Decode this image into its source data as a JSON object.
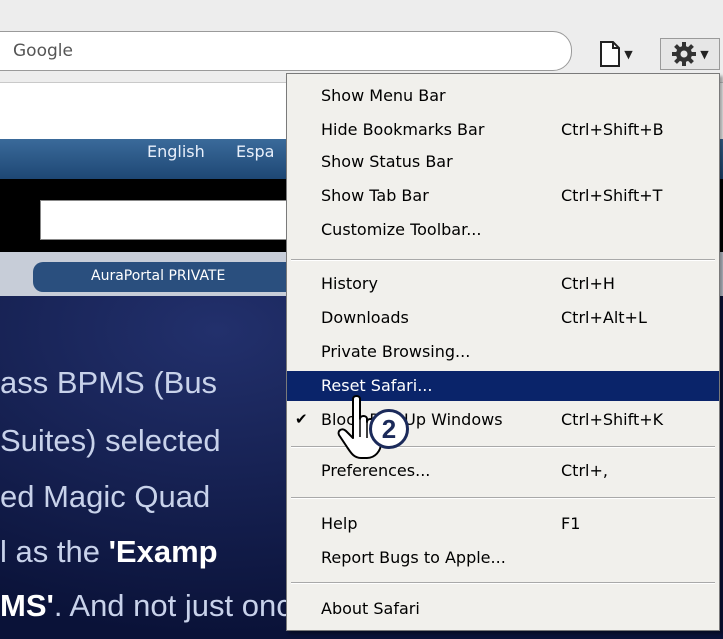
{
  "toolbar": {
    "search_placeholder": "Google",
    "page_icon": "page-icon",
    "gear_icon": "gear-icon"
  },
  "website": {
    "lang_english": "English",
    "lang_espanol": "Espa",
    "nav_text": "AuraPortal  PRIVATE",
    "body_lines": [
      {
        "pre": "ass BPMS (Bus",
        "bold": "",
        "post": ""
      },
      {
        "pre": "Suites) selected",
        "bold": "",
        "post": ""
      },
      {
        "pre": "ed Magic Quad",
        "bold": "",
        "post": ""
      },
      {
        "pre": "l as the ",
        "bold": "'Examp",
        "post": ""
      },
      {
        "pre": "",
        "bold": "MS'",
        "post": ". And not just once"
      }
    ]
  },
  "menu": {
    "items": [
      {
        "label": "Show Menu Bar",
        "shortcut": ""
      },
      {
        "label": "Hide Bookmarks Bar",
        "shortcut": "Ctrl+Shift+B"
      },
      {
        "label": "Show Status Bar",
        "shortcut": ""
      },
      {
        "label": "Show Tab Bar",
        "shortcut": "Ctrl+Shift+T"
      },
      {
        "label": "Customize Toolbar...",
        "shortcut": ""
      },
      {
        "label": "History",
        "shortcut": "Ctrl+H"
      },
      {
        "label": "Downloads",
        "shortcut": "Ctrl+Alt+L"
      },
      {
        "label": "Private Browsing...",
        "shortcut": ""
      },
      {
        "label": "Reset Safari...",
        "shortcut": ""
      },
      {
        "label": "Block Pop-Up Windows",
        "shortcut": "Ctrl+Shift+K",
        "checked": true
      },
      {
        "label": "Preferences...",
        "shortcut": "Ctrl+,"
      },
      {
        "label": "Help",
        "shortcut": "F1"
      },
      {
        "label": "Report Bugs to Apple...",
        "shortcut": ""
      },
      {
        "label": "About Safari",
        "shortcut": ""
      }
    ],
    "selected_index": 8
  },
  "annotation": {
    "step_number": "2"
  },
  "colors": {
    "menu_highlight": "#0a246a",
    "menu_background": "#f1f0ec",
    "site_background": "#0e1a4d"
  }
}
